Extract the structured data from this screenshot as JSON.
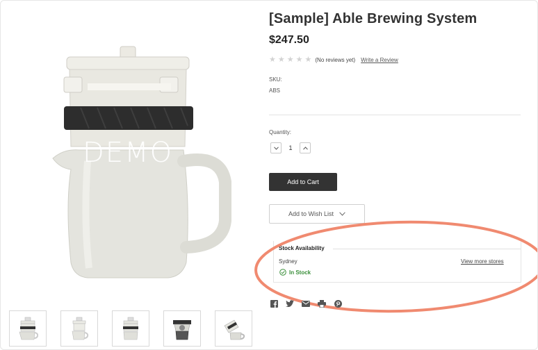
{
  "product": {
    "title": "[Sample] Able Brewing System",
    "price": "$247.50",
    "rating": {
      "stars_filled": 0,
      "stars_total": 5
    },
    "reviews_text": "(No reviews yet)",
    "write_review": "Write a Review",
    "sku_label": "SKU:",
    "sku_value": "ABS",
    "image_watermark": "DEMO"
  },
  "purchase": {
    "quantity_label": "Quantity:",
    "quantity_value": "1",
    "add_to_cart": "Add to Cart",
    "add_to_wishlist": "Add to Wish List"
  },
  "stock": {
    "title": "Stock Availability",
    "store": "Sydney",
    "view_more": "View more stores",
    "status": "In Stock"
  },
  "colors": {
    "accent_dark": "#333333",
    "in_stock_green": "#3a8f3a",
    "highlight_ellipse": "#f08a70"
  },
  "icons": {
    "stars": "star-icon",
    "share": [
      "facebook-icon",
      "twitter-icon",
      "email-icon",
      "print-icon",
      "pinterest-icon"
    ]
  }
}
